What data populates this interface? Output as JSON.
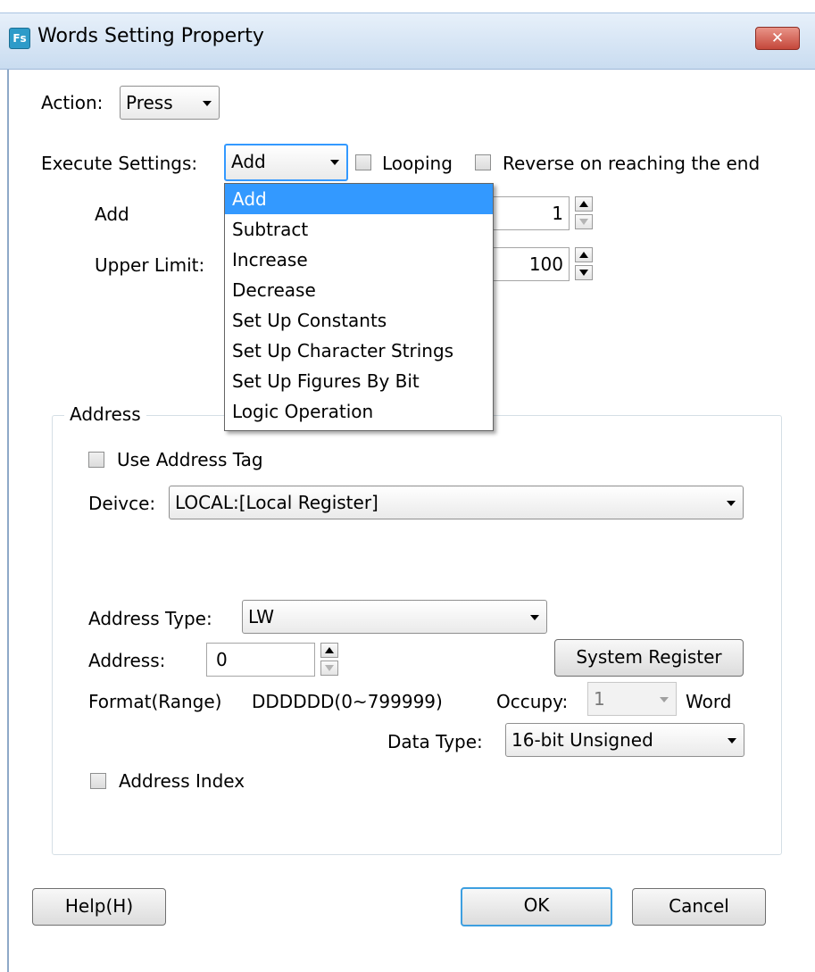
{
  "window": {
    "title": "Words Setting Property",
    "icon_text": "Fs",
    "close_symbol": "✕"
  },
  "action": {
    "label": "Action:",
    "value": "Press"
  },
  "execute": {
    "label": "Execute Settings:",
    "value": "Add",
    "looping_label": "Looping",
    "reverse_label": "Reverse on reaching the end",
    "options": [
      "Add",
      "Subtract",
      "Increase",
      "Decrease",
      "Set Up Constants",
      "Set Up Character Strings",
      "Set Up Figures By Bit",
      "Logic Operation"
    ],
    "selected_index": 0
  },
  "add_field": {
    "label": "Add",
    "value": "1"
  },
  "upper_limit": {
    "label": "Upper Limit:",
    "value": "100"
  },
  "address_group": {
    "title": "Address",
    "use_tag_label": "Use Address Tag",
    "device_label": "Deivce:",
    "device_value": "LOCAL:[Local Register]",
    "address_type_label": "Address Type:",
    "address_type_value": "LW",
    "address_label": "Address:",
    "address_value": "0",
    "system_register_button": "System Register",
    "format_label": "Format(Range)",
    "format_value": "DDDDDD(0~799999)",
    "occupy_label": "Occupy:",
    "occupy_value": "1",
    "occupy_unit": "Word",
    "data_type_label": "Data Type:",
    "data_type_value": "16-bit Unsigned",
    "address_index_label": "Address Index"
  },
  "buttons": {
    "help": "Help(H)",
    "ok": "OK",
    "cancel": "Cancel"
  },
  "colors": {
    "selection": "#3399ff",
    "titlebar": "#dbe8f6",
    "close": "#c4473a"
  }
}
